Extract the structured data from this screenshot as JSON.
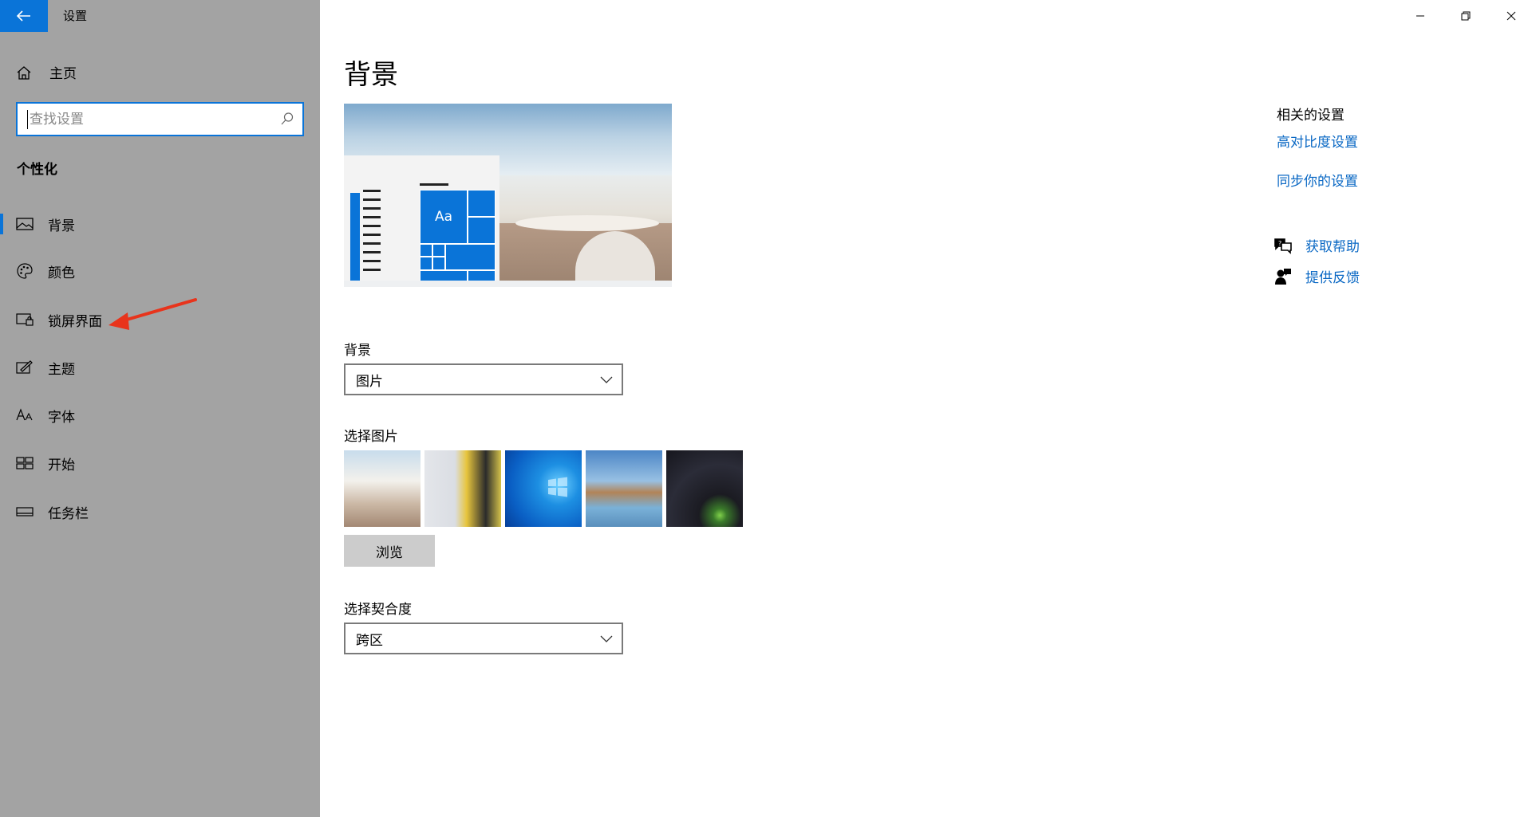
{
  "window": {
    "title": "设置",
    "accent": "#0a74d8",
    "controls": [
      "minimize",
      "restore",
      "close"
    ]
  },
  "sidebar": {
    "home_label": "主页",
    "search_placeholder": "查找设置",
    "section_heading": "个性化",
    "items": [
      {
        "label": "背景",
        "icon": "picture-icon",
        "selected": true
      },
      {
        "label": "颜色",
        "icon": "palette-icon",
        "selected": false
      },
      {
        "label": "锁屏界面",
        "icon": "lock-screen-icon",
        "selected": false
      },
      {
        "label": "主题",
        "icon": "theme-icon",
        "selected": false
      },
      {
        "label": "字体",
        "icon": "font-icon",
        "selected": false
      },
      {
        "label": "开始",
        "icon": "start-icon",
        "selected": false
      },
      {
        "label": "任务栏",
        "icon": "taskbar-icon",
        "selected": false
      }
    ]
  },
  "main": {
    "title": "背景",
    "preview": {
      "tile_label": "Aa"
    },
    "background_label": "背景",
    "background_value": "图片",
    "choose_picture_label": "选择图片",
    "thumbnails": [
      "dining-table",
      "basketball-court",
      "windows-blue",
      "beach-rocks",
      "night-sky-tent"
    ],
    "browse_label": "浏览",
    "fit_label": "选择契合度",
    "fit_value": "跨区"
  },
  "related": {
    "heading": "相关的设置",
    "links": [
      "高对比度设置",
      "同步你的设置"
    ],
    "help_label": "获取帮助",
    "feedback_label": "提供反馈",
    "link_color": "#0a68c4"
  },
  "annotation": {
    "arrow_color": "#e8341c",
    "points_to": "锁屏界面"
  }
}
